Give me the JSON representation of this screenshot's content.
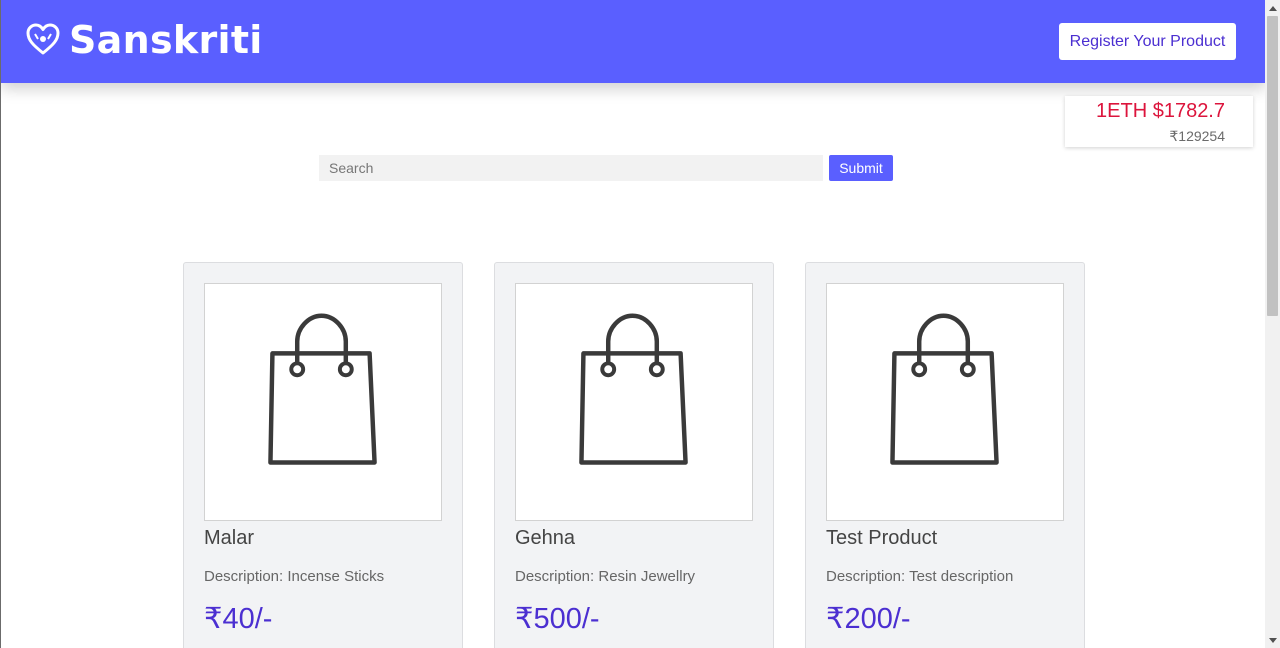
{
  "header": {
    "brand": "Sanskriti",
    "register_label": "Register Your Product"
  },
  "eth_rate": {
    "usd": "1ETH $1782.7",
    "inr": "₹129254"
  },
  "search": {
    "placeholder": "Search",
    "submit_label": "Submit"
  },
  "products": [
    {
      "name": "Malar",
      "description": "Description: Incense Sticks",
      "price": "₹40/-",
      "icon": "shopping-bag-icon"
    },
    {
      "name": "Gehna",
      "description": "Description: Resin Jewellry",
      "price": "₹500/-",
      "icon": "shopping-bag-icon"
    },
    {
      "name": "Test Product",
      "description": "Description: Test description",
      "price": "₹200/-",
      "icon": "shopping-bag-icon"
    }
  ],
  "colors": {
    "header": "#5a5fff",
    "price": "#4b2fd1",
    "eth_rate": "#dc143c"
  }
}
